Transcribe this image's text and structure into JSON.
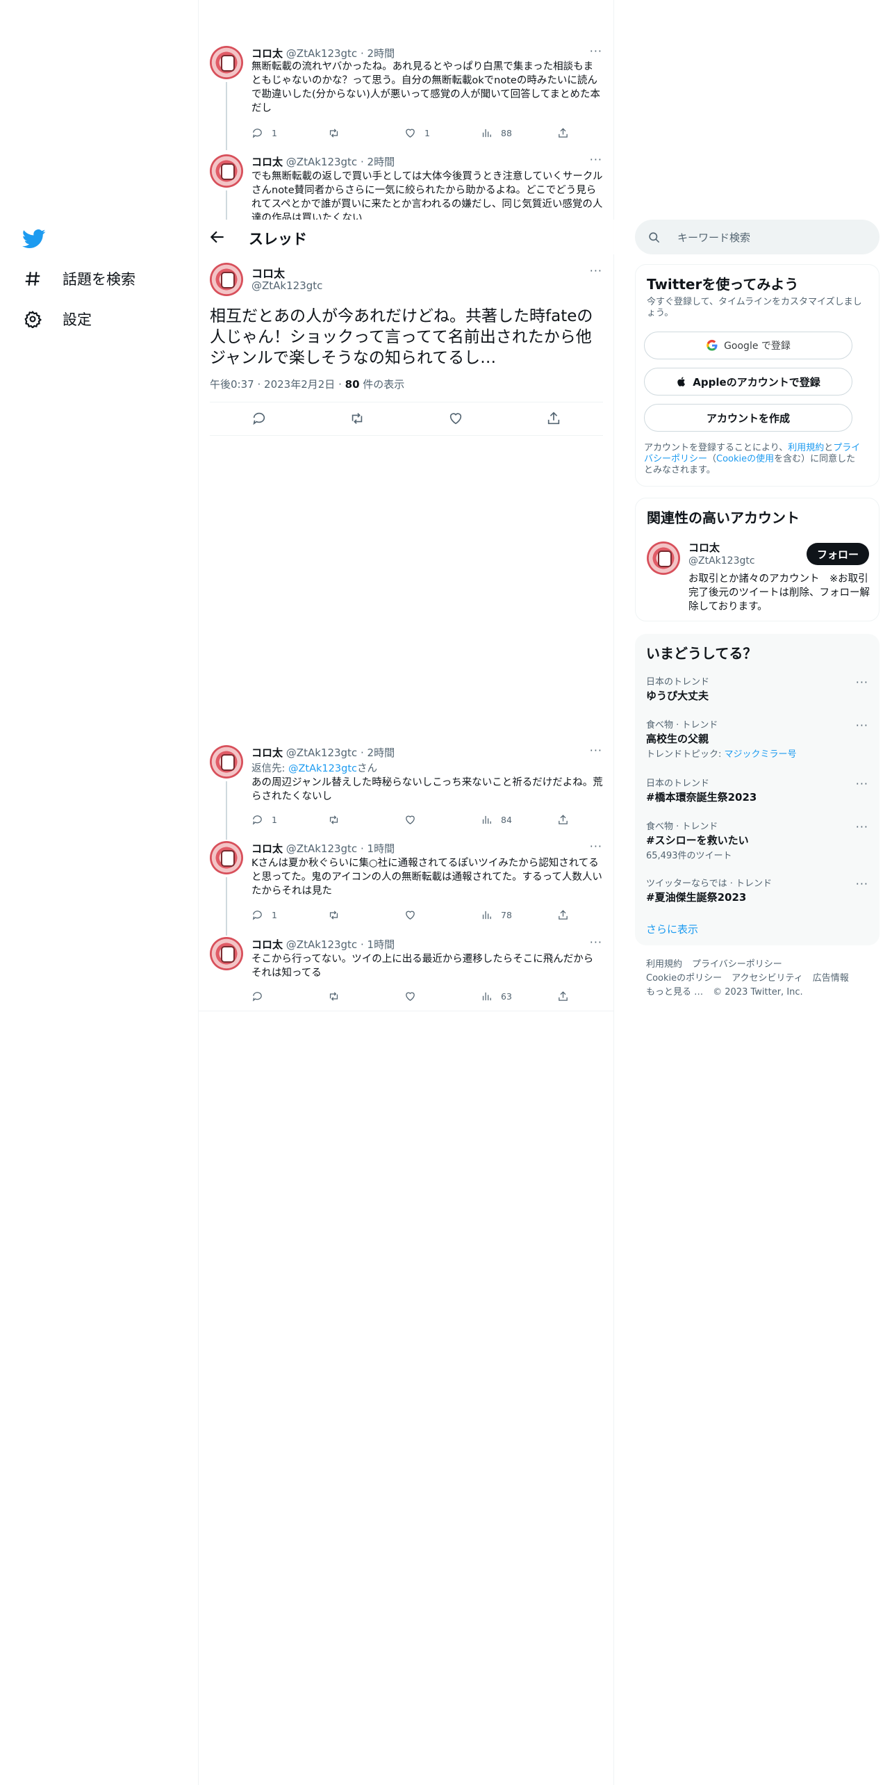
{
  "nav": {
    "logo": "twitter-bird-icon",
    "items": [
      {
        "label": "話題を検索",
        "icon": "hashtag-icon"
      },
      {
        "label": "設定",
        "icon": "gear-icon"
      }
    ]
  },
  "thread": {
    "title": "スレッド",
    "tweets_above": [
      {
        "name": "コロ太",
        "handle": "@ZtAk123gtc",
        "time": "2時間",
        "text": "無断転載の流れヤバかったね。あれ見るとやっぱり白黒で集まった相談もまともじゃないのかな？って思う。自分の無断転載okでnoteの時みたいに読んで勘違いした(分からない)人が悪いって感覚の人が聞いて回答してまとめた本だし",
        "replies": "1",
        "retweets": "",
        "likes": "1",
        "views": "88"
      },
      {
        "name": "コロ太",
        "handle": "@ZtAk123gtc",
        "time": "2時間",
        "text": "でも無断転載の返しで買い手としては大体今後買うとき注意していくサークルさんnote賛同者からさらに一気に絞られたから助かるよね。どこでどう見られてスペとかで誰が買いに来たとか言われるの嫌だし、同じ気質近い感覚の人達の作品は買いたくない",
        "replies": "",
        "retweets": "",
        "likes": "",
        "views": ""
      }
    ],
    "focal": {
      "name": "コロ太",
      "handle": "@ZtAk123gtc",
      "text": "相互だとあの人が今あれだけどね。共著した時fateの人じゃん！ショックって言ってて名前出されたから他ジャンルで楽しそうなの知られてるし…",
      "time": "午後0:37",
      "date": "2023年2月2日",
      "views_count": "80",
      "views_label": "件の表示"
    },
    "replies": [
      {
        "name": "コロ太",
        "handle": "@ZtAk123gtc",
        "time": "2時間",
        "reply_prefix": "返信先:",
        "reply_to": "@ZtAk123gtc",
        "reply_suffix": "さん",
        "text": "あの周辺ジャンル替えした時秘らないしこっち来ないこと祈るだけだよね。荒らされたくないし",
        "replies": "1",
        "retweets": "",
        "likes": "",
        "views": "84"
      },
      {
        "name": "コロ太",
        "handle": "@ZtAk123gtc",
        "time": "1時間",
        "text": "Kさんは夏か秋ぐらいに集○社に通報されてるぽいツイみたから認知されてると思ってた。鬼のアイコンの人の無断転載は通報されてた。するって人数人いたからそれは見た",
        "replies": "1",
        "retweets": "",
        "likes": "",
        "views": "78"
      },
      {
        "name": "コロ太",
        "handle": "@ZtAk123gtc",
        "time": "1時間",
        "text": "そこから行ってない。ツイの上に出る最近から遷移したらそこに飛んだからそれは知ってる",
        "replies": "",
        "retweets": "",
        "likes": "",
        "views": "63"
      }
    ],
    "dot": "·",
    "more": "···"
  },
  "search": {
    "placeholder": "キーワード検索"
  },
  "signup": {
    "title": "Twitterを使ってみよう",
    "subtitle": "今すぐ登録して、タイムラインをカスタマイズしましょう。",
    "google": "Google で登録",
    "apple": "Appleのアカウントで登録",
    "create": "アカウントを作成",
    "legal_1": "アカウントを登録することにより、",
    "legal_terms": "利用規約",
    "legal_2": "と",
    "legal_privacy": "プライバシーポリシー",
    "legal_3": "（",
    "legal_cookie": "Cookieの使用",
    "legal_4": "を含む）に同意したとみなされます。"
  },
  "related": {
    "title": "関連性の高いアカウント",
    "name": "コロ太",
    "handle": "@ZtAk123gtc",
    "bio": "お取引とか諸々のアカウント　※お取引完了後元のツイートは削除、フォロー解除しております。",
    "follow": "フォロー"
  },
  "trends": {
    "title": "いまどうしてる？",
    "items": [
      {
        "category": "日本のトレンド",
        "name": "ゆうぴ大丈夫",
        "meta": ""
      },
      {
        "category": "食べ物 · トレンド",
        "name": "高校生の父親",
        "meta": "トレンドトピック: ",
        "meta_link": "マジックミラー号"
      },
      {
        "category": "日本のトレンド",
        "name": "#橋本環奈誕生祭2023",
        "meta": ""
      },
      {
        "category": "食べ物 · トレンド",
        "name": "#スシローを救いたい",
        "meta": "65,493件のツイート"
      },
      {
        "category": "ツイッターならでは · トレンド",
        "name": "#夏油傑生誕祭2023",
        "meta": ""
      }
    ],
    "show_more": "さらに表示"
  },
  "footer": {
    "terms": "利用規約",
    "privacy": "プライバシーポリシー",
    "cookie": "Cookieのポリシー",
    "accessibility": "アクセシビリティ",
    "ads": "広告情報",
    "more": "もっと見る …",
    "copyright": "© 2023 Twitter, Inc."
  }
}
